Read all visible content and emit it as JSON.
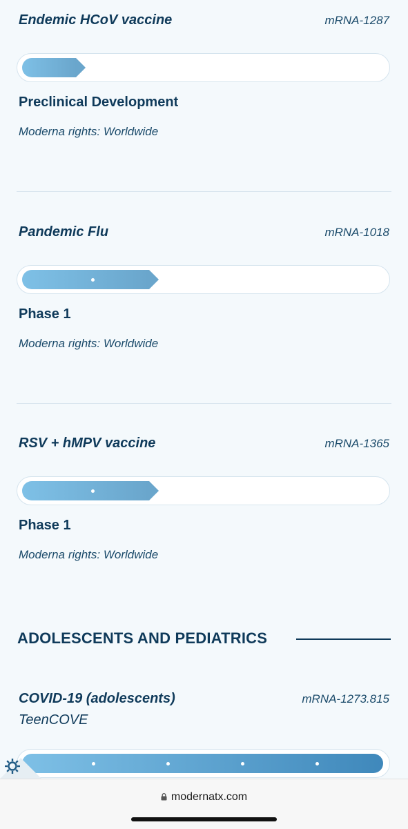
{
  "programs": [
    {
      "name": "Endemic HCoV vaccine",
      "code": "mRNA-1287",
      "stage": "Preclinical Development",
      "rights": "Moderna rights: Worldwide",
      "progress_fraction": 0.17
    },
    {
      "name": "Pandemic Flu",
      "code": "mRNA-1018",
      "stage": "Phase 1",
      "rights": "Moderna rights: Worldwide",
      "progress_fraction": 0.37
    },
    {
      "name": "RSV + hMPV vaccine",
      "code": "mRNA-1365",
      "stage": "Phase 1",
      "rights": "Moderna rights: Worldwide",
      "progress_fraction": 0.37
    }
  ],
  "section": {
    "title": "ADOLESCENTS AND PEDIATRICS"
  },
  "teen_program": {
    "name": "COVID-19 (adolescents)",
    "code": "mRNA-1273.815",
    "subtitle": "TeenCOVE",
    "progress_fraction": 1.0
  },
  "browser": {
    "url": "modernatx.com"
  },
  "colors": {
    "primary_text": "#0f3a5a",
    "bar_start": "#7ec0e6",
    "bar_end": "#3f88bb",
    "background": "#f4f9fc"
  },
  "icons": [
    "gear-icon",
    "lock-icon"
  ]
}
